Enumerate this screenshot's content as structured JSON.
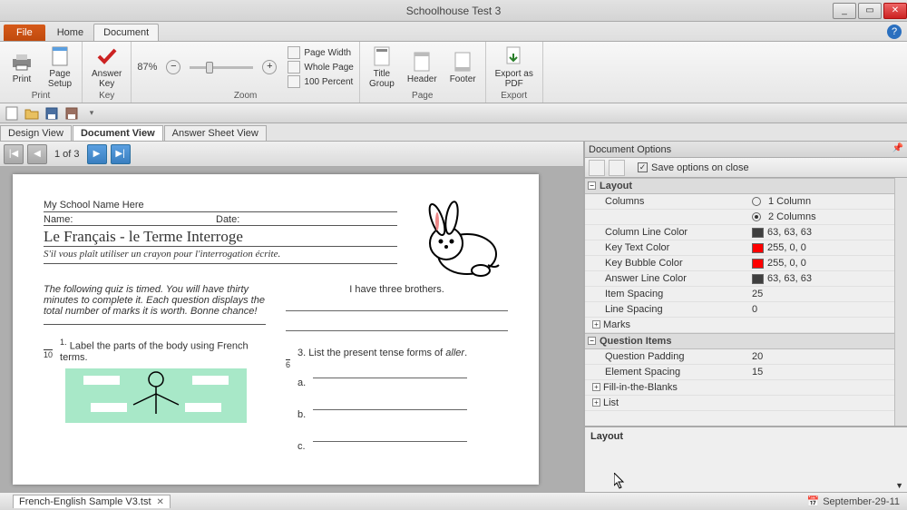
{
  "app_title": "Schoolhouse Test 3",
  "tabs": {
    "file": "File",
    "home": "Home",
    "document": "Document"
  },
  "ribbon": {
    "print": {
      "print": "Print",
      "page_setup": "Page\nSetup",
      "group": "Print"
    },
    "key": {
      "answer_key": "Answer\nKey",
      "group": "Key"
    },
    "zoom": {
      "pct": "87%",
      "page_width": "Page Width",
      "whole_page": "Whole Page",
      "percent_100": "100 Percent",
      "group": "Zoom"
    },
    "page": {
      "title_group": "Title\nGroup",
      "header": "Header",
      "footer": "Footer",
      "group": "Page"
    },
    "export": {
      "export_pdf": "Export as\nPDF",
      "group": "Export"
    }
  },
  "view_tabs": {
    "design": "Design View",
    "document": "Document View",
    "answer": "Answer Sheet View"
  },
  "pager": {
    "count": "1 of 3"
  },
  "doc": {
    "school": "My School Name Here",
    "name_label": "Name:",
    "date_label": "Date:",
    "title": "Le Français - le Terme Interroge",
    "subtitle": "S'il vous plaît utiliser un crayon pour l'interrogation écrite.",
    "intro": "The following quiz is timed. You will have thirty minutes to complete it. Each question displays the total number of marks it is worth. Bonne chance!",
    "q1_marks": "10",
    "q1_num": "1.",
    "q1_text": "Label the parts of the body using French terms.",
    "q2_text": "I have three brothers.",
    "q3_marks": "6",
    "q3_num": "3.",
    "q3_text_a": "List the present tense forms of ",
    "q3_text_b": "aller",
    "q3_text_c": ".",
    "letters": {
      "a": "a.",
      "b": "b.",
      "c": "c."
    }
  },
  "panel": {
    "title": "Document Options",
    "save_on_close": "Save options on close",
    "layout_cat": "Layout",
    "columns": "Columns",
    "col1": "1 Column",
    "col2": "2 Columns",
    "column_line_color": "Column Line Color",
    "column_line_color_v": "63, 63, 63",
    "key_text_color": "Key Text Color",
    "key_text_color_v": "255, 0, 0",
    "key_bubble_color": "Key Bubble Color",
    "key_bubble_color_v": "255, 0, 0",
    "answer_line_color": "Answer Line Color",
    "answer_line_color_v": "63, 63, 63",
    "item_spacing": "Item Spacing",
    "item_spacing_v": "25",
    "line_spacing": "Line Spacing",
    "line_spacing_v": "0",
    "marks": "Marks",
    "question_items": "Question Items",
    "question_padding": "Question Padding",
    "question_padding_v": "20",
    "element_spacing": "Element Spacing",
    "element_spacing_v": "15",
    "fill_blanks": "Fill-in-the-Blanks",
    "list": "List",
    "desc_title": "Layout"
  },
  "footer": {
    "doc_name": "French-English Sample V3.tst",
    "date": "September-29-11"
  }
}
